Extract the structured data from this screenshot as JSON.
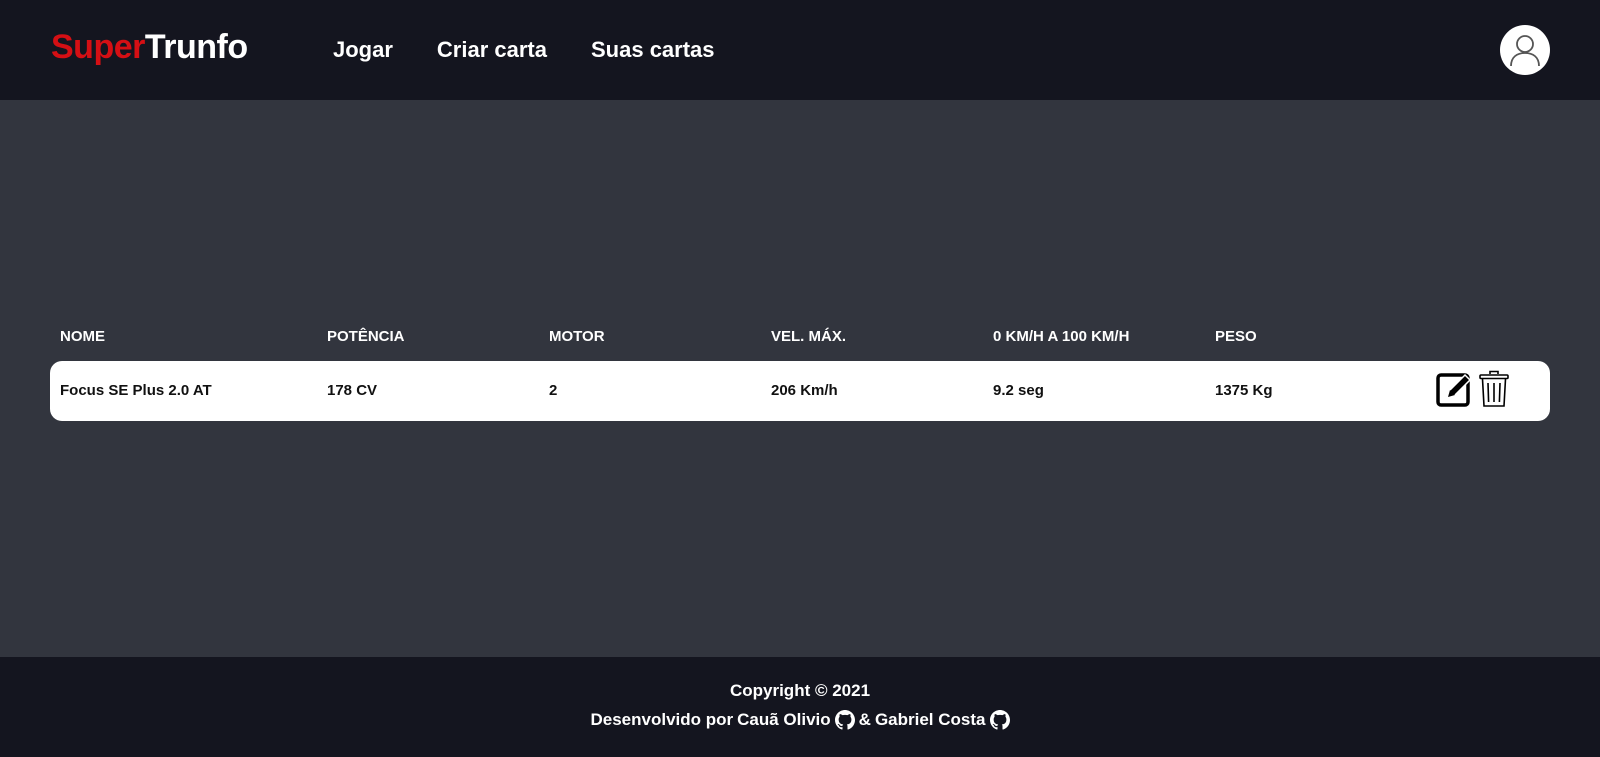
{
  "header": {
    "logo_part1": "Super",
    "logo_part2": "Trunfo",
    "nav": [
      "Jogar",
      "Criar carta",
      "Suas cartas"
    ],
    "profile_icon": "user-icon"
  },
  "table": {
    "headers": [
      "NOME",
      "POTÊNCIA",
      "MOTOR",
      "VEL. MÁX.",
      "0 KM/H A 100 KM/H",
      "PESO"
    ],
    "rows": [
      {
        "nome": "Focus SE Plus 2.0 AT",
        "potencia": "178 CV",
        "motor": "2",
        "vel_max": "206 Km/h",
        "aceleracao": "9.2 seg",
        "peso": "1375 Kg",
        "edit_icon": "edit-icon",
        "delete_icon": "trash-icon"
      }
    ]
  },
  "footer": {
    "copyright": "Copyright © 2021",
    "dev_prefix": "Desenvolvido por",
    "dev1": "Cauã Olivio",
    "separator": "&",
    "dev2": "Gabriel Costa",
    "github_icon": "github-icon"
  },
  "colors": {
    "header_bg": "#14151f",
    "body_bg": "#32353e",
    "accent_red": "#d50f14"
  }
}
